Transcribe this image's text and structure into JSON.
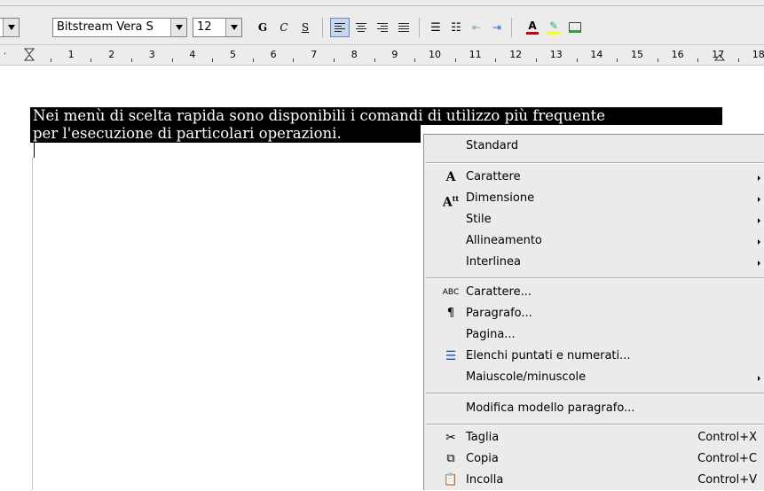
{
  "toolbar": {
    "font_name": "Bitstream Vera S",
    "font_size": "12",
    "bold": "G",
    "italic": "C",
    "underline": "S"
  },
  "ruler": {
    "numbers": [
      "1",
      "2",
      "3",
      "4",
      "5",
      "6",
      "7",
      "8",
      "9",
      "10",
      "11",
      "12",
      "13",
      "14",
      "15",
      "16",
      "17",
      "18"
    ]
  },
  "document": {
    "line1": "Nei menù di scelta rapida sono disponibili i comandi di utilizzo più frequente",
    "line2": "per l'esecuzione di particolari operazioni."
  },
  "menu": {
    "standard": "Standard",
    "carattere_sub": "Carattere",
    "dimensione": "Dimensione",
    "stile": "Stile",
    "allineamento": "Allineamento",
    "interlinea": "Interlinea",
    "carattere_dlg": "Carattere...",
    "paragrafo": "Paragrafo...",
    "pagina": "Pagina...",
    "elenchi": "Elenchi puntati e numerati...",
    "maiuscole": "Maiuscole/minuscole",
    "modifica": "Modifica modello paragrafo...",
    "taglia": "Taglia",
    "taglia_sc": "Control+X",
    "copia": "Copia",
    "copia_sc": "Control+C",
    "incolla": "Incolla",
    "incolla_sc": "Control+V"
  },
  "colors": {
    "toolbar_bg": "#ececec",
    "menu_bg": "#ebebeb",
    "selection_bg": "#000000",
    "font_color_icon": "#cc0000",
    "highlight_icon": "#ffff00"
  }
}
